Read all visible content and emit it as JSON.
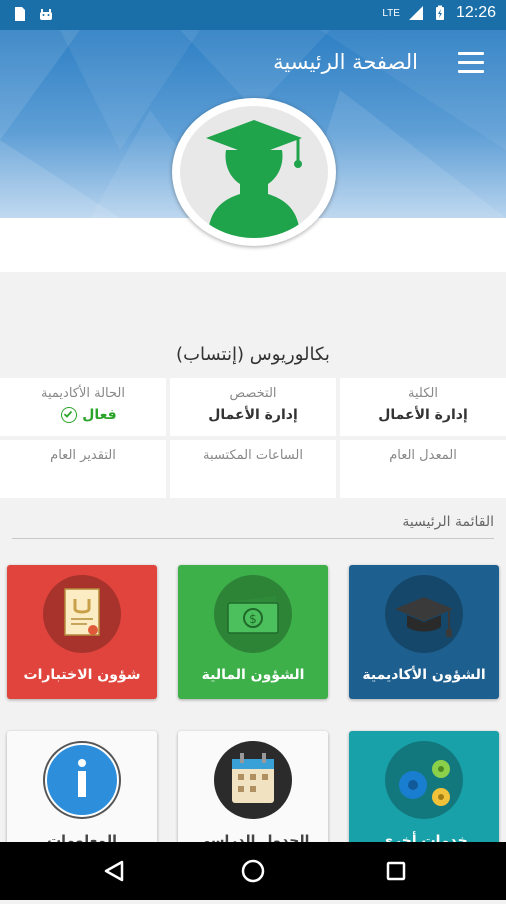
{
  "status_bar": {
    "time": "12:26",
    "network": "LTE",
    "icons": [
      "sd-card-icon",
      "android-icon",
      "signal-icon",
      "battery-icon"
    ]
  },
  "header": {
    "title": "الصفحة الرئيسية",
    "menu_icon": "hamburger-menu-icon"
  },
  "profile": {
    "avatar_icon": "graduate-avatar-icon",
    "degree": "بكالوريوس (إنتساب)"
  },
  "info": {
    "college_label": "الكلية",
    "college_value": "إدارة الأعمال",
    "major_label": "التخصص",
    "major_value": "إدارة الأعمال",
    "status_label": "الحالة الأكاديمية",
    "status_value": "فعال",
    "gpa_label": "المعدل العام",
    "hours_label": "الساعات المكتسبة",
    "grade_label": "التقدير العام"
  },
  "main_menu": {
    "title": "القائمة الرئيسية",
    "tiles": [
      {
        "label": "الشؤون الأكاديمية",
        "icon": "graduation-cap-icon",
        "color": "#1d5f8e"
      },
      {
        "label": "الشؤون المالية",
        "icon": "money-icon",
        "color": "#3db04a"
      },
      {
        "label": "شؤون الاختبارات",
        "icon": "certificate-icon",
        "color": "#e0443c"
      },
      {
        "label": "خدمات أخرى",
        "icon": "gears-icon",
        "color": "#18a1a8"
      },
      {
        "label": "الجدول الدراسي",
        "icon": "calendar-icon",
        "color": "#ffffff"
      },
      {
        "label": "المعلومات",
        "icon": "info-icon",
        "color": "#ffffff"
      }
    ]
  },
  "nav": {
    "back_icon": "back-icon",
    "home_icon": "home-icon",
    "recents_icon": "recents-icon"
  }
}
